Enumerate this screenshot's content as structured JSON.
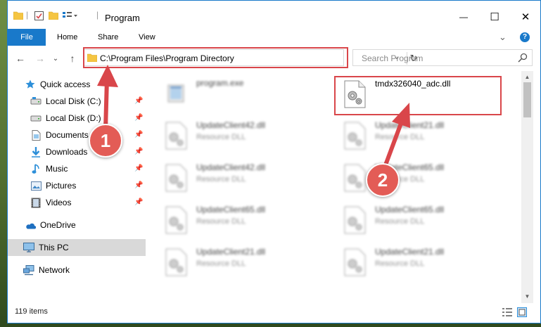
{
  "window": {
    "title": "Program",
    "minimize_glyph": "—",
    "maximize_glyph": "☐",
    "close_glyph": "✕"
  },
  "ribbon": {
    "tabs": [
      "File",
      "Home",
      "Share",
      "View"
    ],
    "expand_glyph": "⌄",
    "help_glyph": "?"
  },
  "nav": {
    "back_glyph": "←",
    "forward_glyph": "→",
    "recent_glyph": "⌄",
    "up_glyph": "↑"
  },
  "address": {
    "path": "C:\\Program Files\\Program Directory",
    "dropdown_glyph": "⌄",
    "refresh_glyph": "↻"
  },
  "search": {
    "placeholder": "Search Program"
  },
  "sidebar": {
    "items": [
      {
        "label": "Quick access",
        "icon": "star-icon",
        "pinned": false
      },
      {
        "label": "Local Disk (C:)",
        "icon": "drive-icon",
        "pinned": true
      },
      {
        "label": "Local Disk (D:)",
        "icon": "drive-icon",
        "pinned": true
      },
      {
        "label": "Documents",
        "icon": "documents-icon",
        "pinned": true
      },
      {
        "label": "Downloads",
        "icon": "downloads-icon",
        "pinned": true
      },
      {
        "label": "Music",
        "icon": "music-icon",
        "pinned": true
      },
      {
        "label": "Pictures",
        "icon": "pictures-icon",
        "pinned": true
      },
      {
        "label": "Videos",
        "icon": "videos-icon",
        "pinned": true
      },
      {
        "label": "OneDrive",
        "icon": "onedrive-icon",
        "pinned": false
      },
      {
        "label": "This PC",
        "icon": "computer-icon",
        "pinned": false,
        "selected": true
      },
      {
        "label": "Network",
        "icon": "network-icon",
        "pinned": false
      }
    ],
    "pin_glyph": "📌"
  },
  "files": [
    {
      "name": "program.exe",
      "desc": "",
      "blurred": true
    },
    {
      "name": "tmdx326040_adc.dll",
      "desc": "",
      "blurred": false,
      "highlighted": true
    },
    {
      "name": "UpdateClient42.dll",
      "desc": "Resource DLL",
      "blurred": true
    },
    {
      "name": "UpdateClient21.dll",
      "desc": "Resource DLL",
      "blurred": true
    },
    {
      "name": "UpdateClient42.dll",
      "desc": "Resource DLL",
      "blurred": true
    },
    {
      "name": "UpdateClient65.dll",
      "desc": "Resource DLL",
      "blurred": true
    },
    {
      "name": "UpdateClient65.dll",
      "desc": "Resource DLL",
      "blurred": true
    },
    {
      "name": "UpdateClient65.dll",
      "desc": "Resource DLL",
      "blurred": true
    },
    {
      "name": "UpdateClient21.dll",
      "desc": "Resource DLL",
      "blurred": true
    },
    {
      "name": "UpdateClient21.dll",
      "desc": "Resource DLL",
      "blurred": true
    }
  ],
  "status": {
    "count": "119 items"
  },
  "annotations": {
    "step1": "1",
    "step2": "2",
    "color": "#d9464a"
  },
  "colors": {
    "accent": "#1979ca",
    "highlight": "#d9464a",
    "marker": "#e35c56"
  }
}
